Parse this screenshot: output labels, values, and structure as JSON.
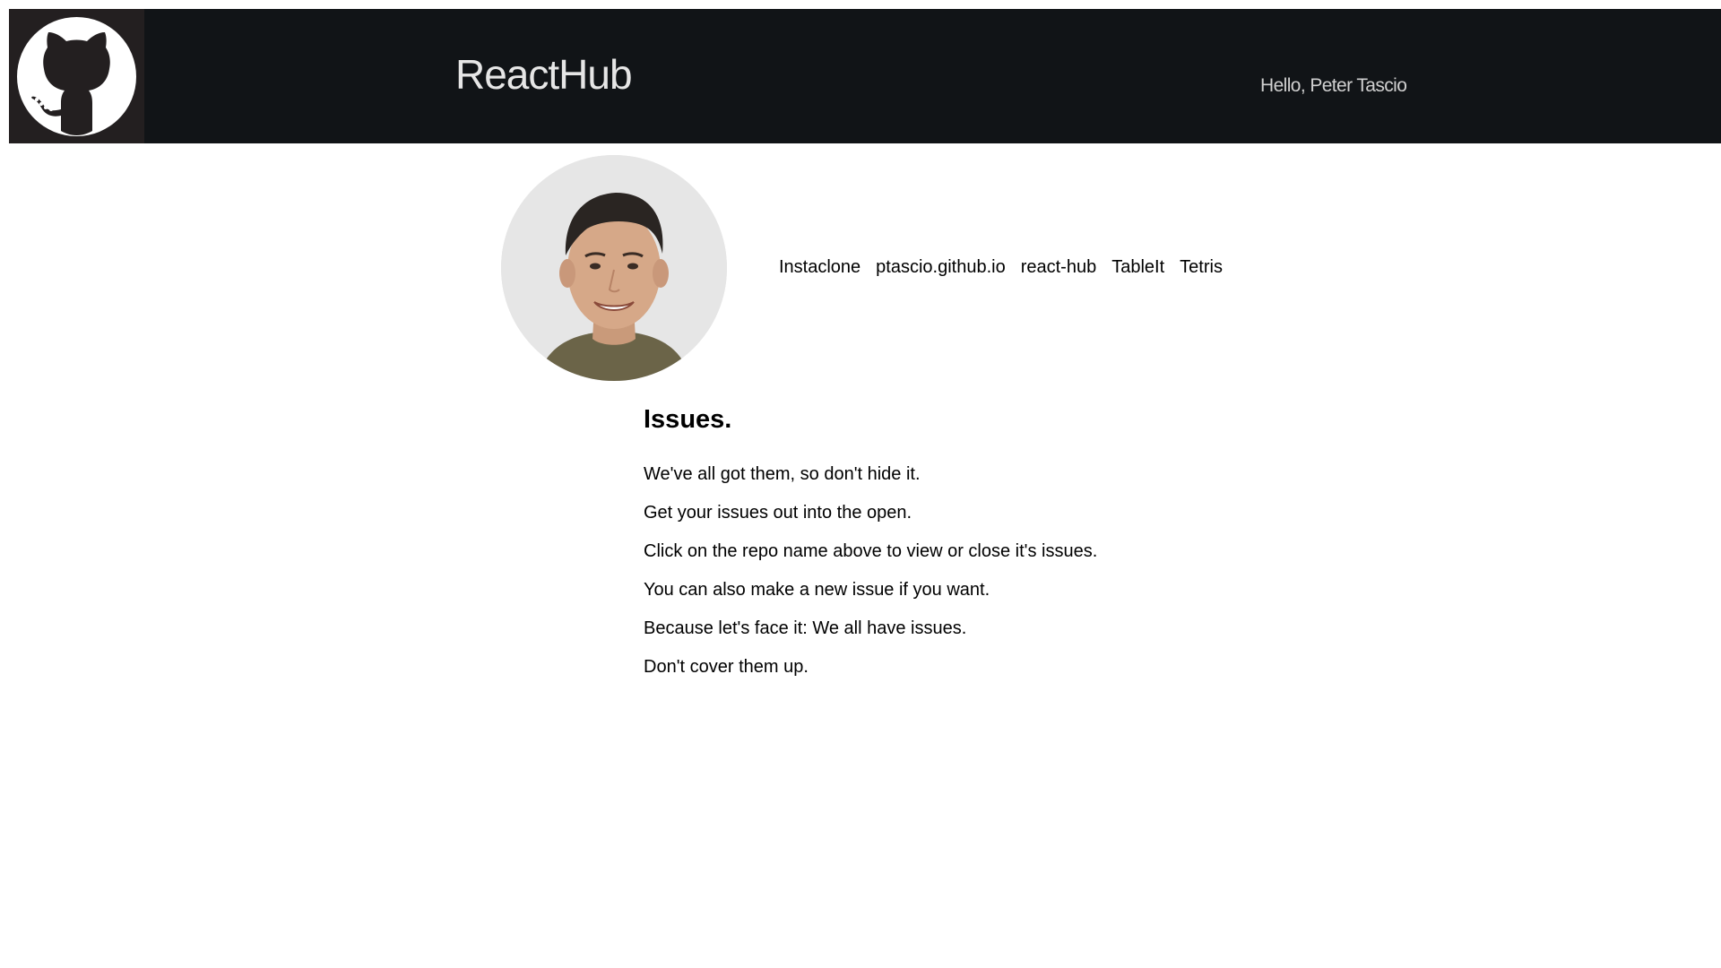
{
  "header": {
    "logo_icon": "github-octocat-icon",
    "title": "ReactHub",
    "greeting": "Hello, Peter Tascio"
  },
  "profile": {
    "avatar_icon": "user-avatar-photo"
  },
  "repos": [
    {
      "label": "Instaclone"
    },
    {
      "label": "ptascio.github.io"
    },
    {
      "label": "react-hub"
    },
    {
      "label": "TableIt"
    },
    {
      "label": "Tetris"
    }
  ],
  "issues": {
    "heading": "Issues.",
    "lines": [
      "We've all got them, so don't hide it.",
      "Get your issues out into the open.",
      "Click on the repo name above to view or close it's issues.",
      "You can also make a new issue if you want.",
      "Because let's face it: We all have issues.",
      "Don't cover them up."
    ]
  },
  "colors": {
    "header_bg": "#111417",
    "logo_bg": "#231f20",
    "header_text": "#e6e6e6",
    "page_bg": "#ffffff"
  }
}
